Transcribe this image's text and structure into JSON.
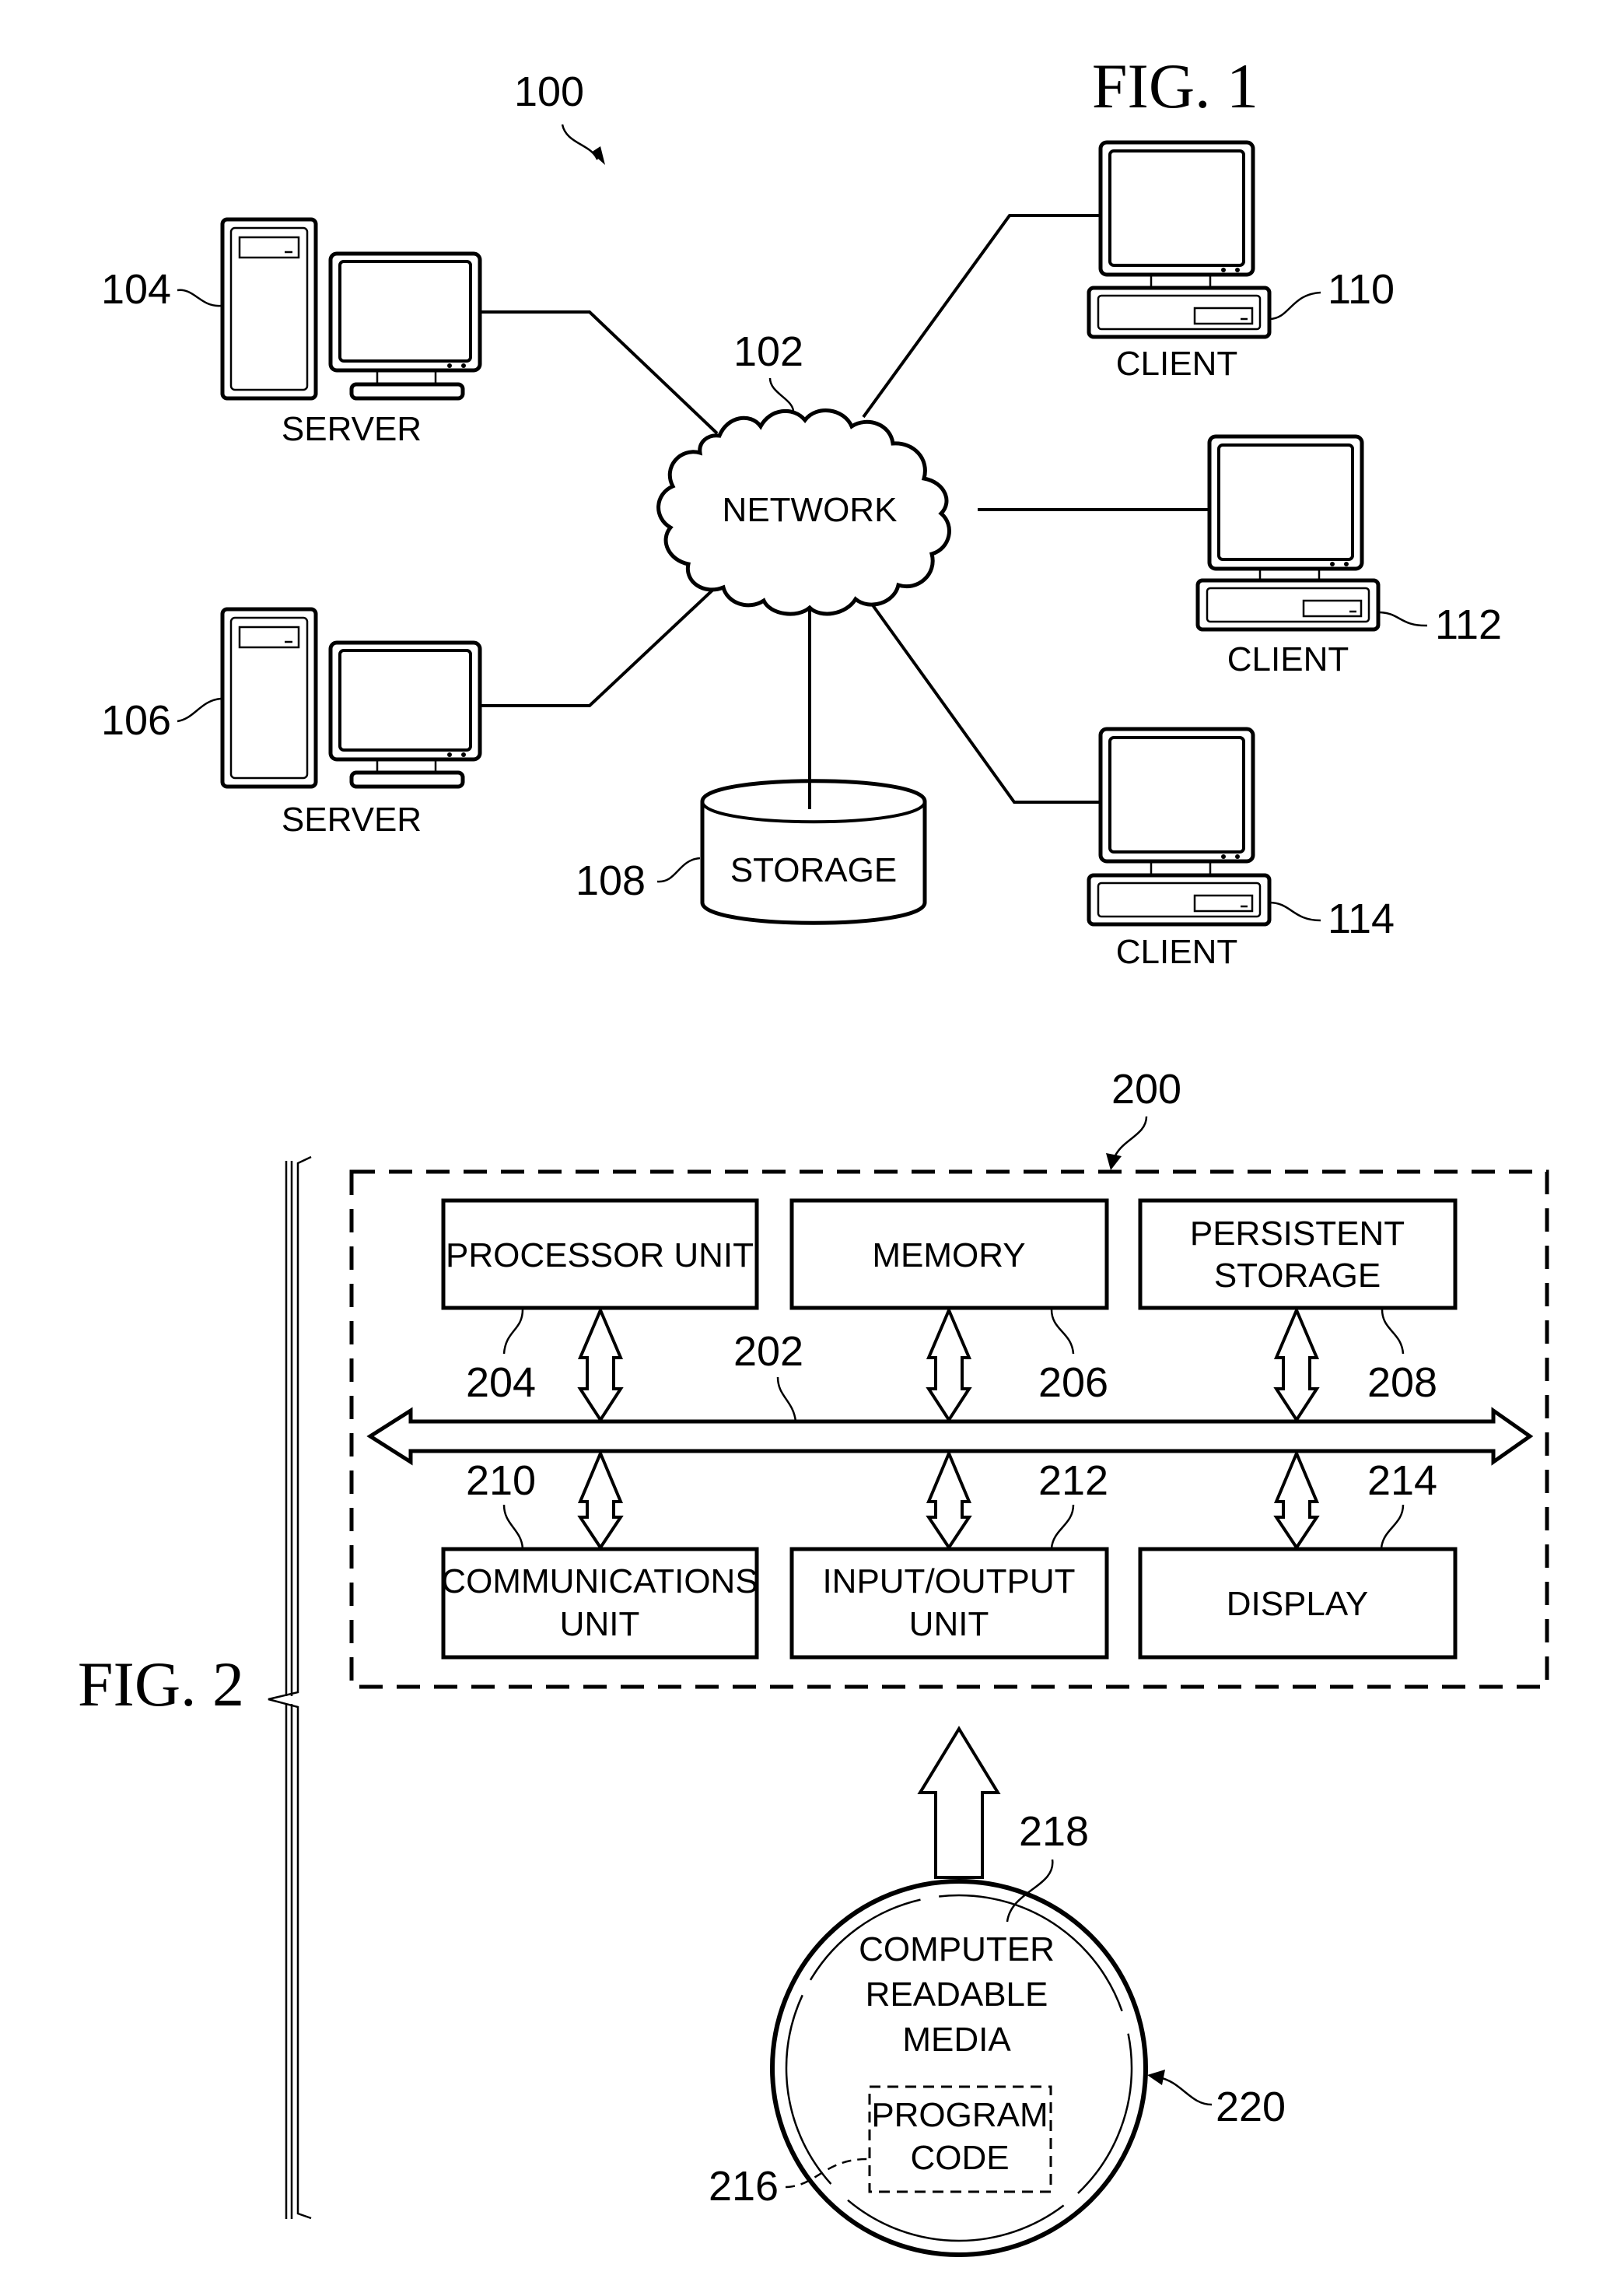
{
  "fig1": {
    "title": "FIG. 1",
    "system_ref": "100",
    "network": {
      "label": "NETWORK",
      "ref": "102"
    },
    "servers": [
      {
        "label": "SERVER",
        "ref": "104"
      },
      {
        "label": "SERVER",
        "ref": "106"
      }
    ],
    "storage": {
      "label": "STORAGE",
      "ref": "108"
    },
    "clients": [
      {
        "label": "CLIENT",
        "ref": "110"
      },
      {
        "label": "CLIENT",
        "ref": "112"
      },
      {
        "label": "CLIENT",
        "ref": "114"
      }
    ]
  },
  "fig2": {
    "title": "FIG. 2",
    "system_ref": "200",
    "bus_ref": "202",
    "components": [
      {
        "lines": [
          "PROCESSOR UNIT"
        ],
        "ref": "204"
      },
      {
        "lines": [
          "MEMORY"
        ],
        "ref": "206"
      },
      {
        "lines": [
          "PERSISTENT",
          "STORAGE"
        ],
        "ref": "208"
      },
      {
        "lines": [
          "COMMUNICATIONS",
          "UNIT"
        ],
        "ref": "210"
      },
      {
        "lines": [
          "INPUT/OUTPUT",
          "UNIT"
        ],
        "ref": "212"
      },
      {
        "lines": [
          "DISPLAY"
        ],
        "ref": "214"
      }
    ],
    "media": {
      "lines": [
        "COMPUTER",
        "READABLE",
        "MEDIA"
      ],
      "ref": "218",
      "product_ref": "220",
      "program_code": {
        "lines": [
          "PROGRAM",
          "CODE"
        ],
        "ref": "216"
      }
    }
  }
}
